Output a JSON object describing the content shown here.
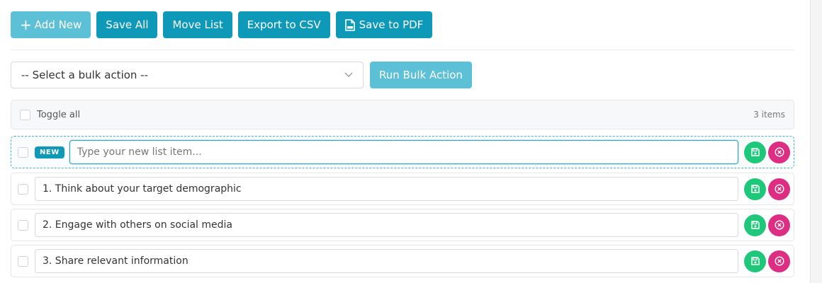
{
  "toolbar": {
    "add_new": "Add New",
    "save_all": "Save All",
    "move_list": "Move List",
    "export_csv": "Export to CSV",
    "save_pdf": "Save to PDF"
  },
  "bulk": {
    "select_value": "-- Select a bulk action --",
    "run_label": "Run Bulk Action"
  },
  "list_header": {
    "toggle_all": "Toggle all",
    "count": "3 items"
  },
  "new_item": {
    "badge": "NEW",
    "placeholder": "Type your new list item...",
    "value": ""
  },
  "items": [
    {
      "value": "1. Think about your target demographic"
    },
    {
      "value": "2. Engage with others on social media"
    },
    {
      "value": "3. Share relevant information"
    }
  ],
  "colors": {
    "primary": "#0f99b8",
    "primary_light": "#5cc1d6",
    "save": "#1fc77a",
    "delete": "#dc2e82"
  }
}
